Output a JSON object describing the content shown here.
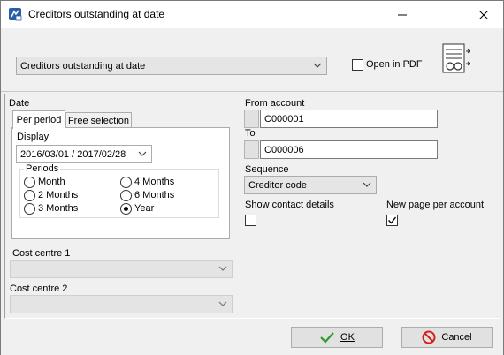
{
  "window": {
    "title": "Creditors outstanding at date"
  },
  "header": {
    "report_select": "Creditors outstanding at date",
    "open_in_pdf_label": "Open in PDF",
    "open_in_pdf_checked": false
  },
  "date": {
    "section_label": "Date",
    "tabs": [
      {
        "label": "Per period",
        "active": true
      },
      {
        "label": "Free selection",
        "active": false
      }
    ],
    "display_label": "Display",
    "display_value": "2016/03/01 / 2017/02/28",
    "periods_label": "Periods",
    "periods": [
      {
        "label": "Month",
        "checked": false
      },
      {
        "label": "4 Months",
        "checked": false
      },
      {
        "label": "2 Months",
        "checked": false
      },
      {
        "label": "6 Months",
        "checked": false
      },
      {
        "label": "3 Months",
        "checked": false
      },
      {
        "label": "Year",
        "checked": true
      }
    ]
  },
  "cost_centres": {
    "cc1_label": "Cost centre 1",
    "cc1_value": "",
    "cc2_label": "Cost centre 2",
    "cc2_value": ""
  },
  "account": {
    "from_label": "From account",
    "from_value": "C000001",
    "to_label": "To",
    "to_value": "C000006"
  },
  "sequence": {
    "label": "Sequence",
    "value": "Creditor code"
  },
  "options": {
    "show_contact_label": "Show contact details",
    "show_contact_checked": false,
    "new_page_label": "New page per account",
    "new_page_checked": true
  },
  "footer": {
    "ok_label": "OK",
    "cancel_label": "Cancel"
  },
  "colors": {
    "window_bg": "#f0f0f0",
    "ok_check": "#2e9b2e",
    "cancel_icon": "#d4201c"
  }
}
